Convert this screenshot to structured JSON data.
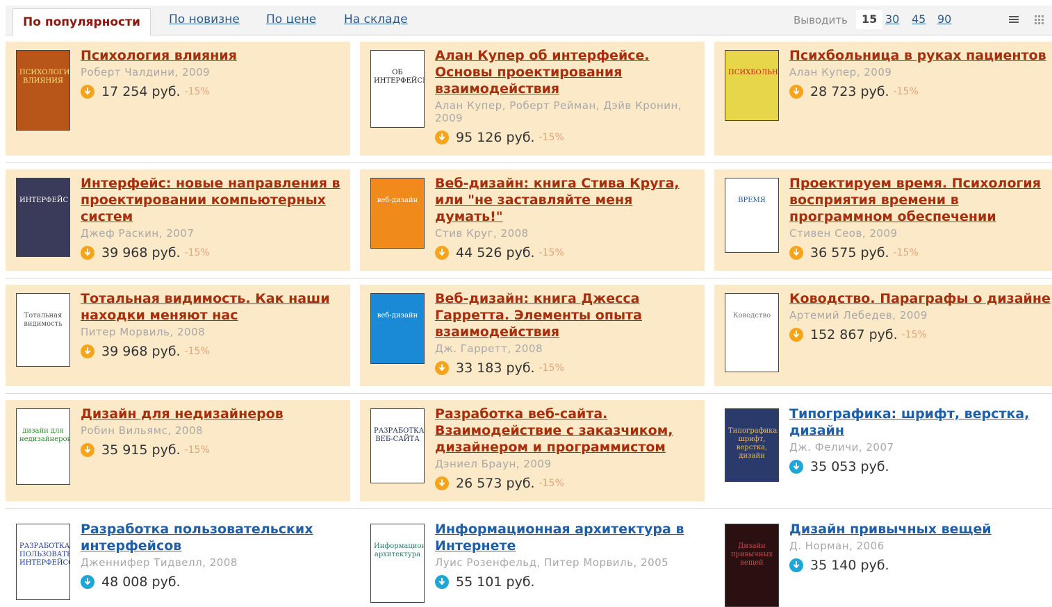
{
  "toolbar": {
    "sort_tabs": [
      "По популярности",
      "По новизне",
      "По цене",
      "На складе"
    ],
    "show_label": "Выводить",
    "per_page_current": "15",
    "per_page_options": [
      "30",
      "45",
      "90"
    ]
  },
  "books": [
    {
      "title": "Психология влияния",
      "author": "Роберт Чалдини, 2009",
      "price": "17 254 руб.",
      "discount": "-15%",
      "cover_text": "ПСИХОЛОГИЯ ВЛИЯНИЯ"
    },
    {
      "title": "Алан Купер об интерфейсе. Основы проектирования взаимодействия",
      "author": "Алан Купер, Роберт Рейман, Дэйв Кронин, 2009",
      "price": "95 126 руб.",
      "discount": "-15%",
      "cover_text": "ОБ ИНТЕРФЕЙСЕ"
    },
    {
      "title": "Психбольница в руках пациентов",
      "author": "Алан Купер, 2009",
      "price": "28 723 руб.",
      "discount": "-15%",
      "cover_text": "ПСИХБОЛЬНИЦА"
    },
    {
      "title": "Интерфейс: новые направления в проектировании компьютерных систем",
      "author": "Джеф Раскин, 2007",
      "price": "39 968 руб.",
      "discount": "-15%",
      "cover_text": "ИНТЕРФЕЙС"
    },
    {
      "title": "Веб-дизайн: книга Стива Круга, или \"не заставляйте меня думать!\"",
      "author": "Стив Круг, 2008",
      "price": "44 526 руб.",
      "discount": "-15%",
      "cover_text": "веб-дизайн"
    },
    {
      "title": "Проектируем время. Психология восприятия времени в программном обеспечении",
      "author": "Стивен Сеов, 2009",
      "price": "36 575 руб.",
      "discount": "-15%",
      "cover_text": "ВРЕМЯ"
    },
    {
      "title": "Тотальная видимость. Как наши находки меняют нас",
      "author": "Питер Морвиль, 2008",
      "price": "39 968 руб.",
      "discount": "-15%",
      "cover_text": "Тотальная видимость"
    },
    {
      "title": "Веб-дизайн: книга Джесса Гарретта. Элементы опыта взаимодействия",
      "author": "Дж. Гарретт, 2008",
      "price": "33 183 руб.",
      "discount": "-15%",
      "cover_text": "веб-дизайн"
    },
    {
      "title": "Ководство. Параграфы о дизайне",
      "author": "Артемий Лебедев, 2009",
      "price": "152 867 руб.",
      "discount": "-15%",
      "cover_text": "Ководство"
    },
    {
      "title": "Дизайн для недизайнеров",
      "author": "Робин Вильямс, 2008",
      "price": "35 915 руб.",
      "discount": "-15%",
      "cover_text": "дизайн для недизайнеров"
    },
    {
      "title": "Разработка веб-сайта. Взаимодействие с заказчиком, дизайнером и программистом",
      "author": "Дэниел Браун, 2009",
      "price": "26 573 руб.",
      "discount": "-15%",
      "cover_text": "РАЗРАБОТКА ВЕБ-САЙТА"
    },
    {
      "title": "Типографика: шрифт, верстка, дизайн",
      "author": "Дж. Феличи, 2007",
      "price": "35 053 руб.",
      "discount": "",
      "cover_text": "Типографика: шрифт, верстка, дизайн"
    },
    {
      "title": "Разработка пользовательских интерфейсов",
      "author": "Дженнифер Тидвелл, 2008",
      "price": "48 008 руб.",
      "discount": "",
      "cover_text": "РАЗРАБОТКА ПОЛЬЗОВАТЕЛЬСКИХ ИНТЕРФЕЙСОВ"
    },
    {
      "title": "Информационная архитектура в Интернете",
      "author": "Луис Розенфельд, Питер Морвиль, 2005",
      "price": "55 101 руб.",
      "discount": "",
      "cover_text": "Информационная архитектура"
    },
    {
      "title": "Дизайн привычных вещей",
      "author": "Д. Норман, 2006",
      "price": "35 140 руб.",
      "discount": "",
      "cover_text": "Дизайн привычных вещей"
    }
  ],
  "colors": {
    "card_bg": "#fbe9c8",
    "title_in_stock": "#a62f0e",
    "title_order": "#1f5fa8",
    "coin_discount": "#f5a41b",
    "coin_regular": "#1ea6d6"
  }
}
